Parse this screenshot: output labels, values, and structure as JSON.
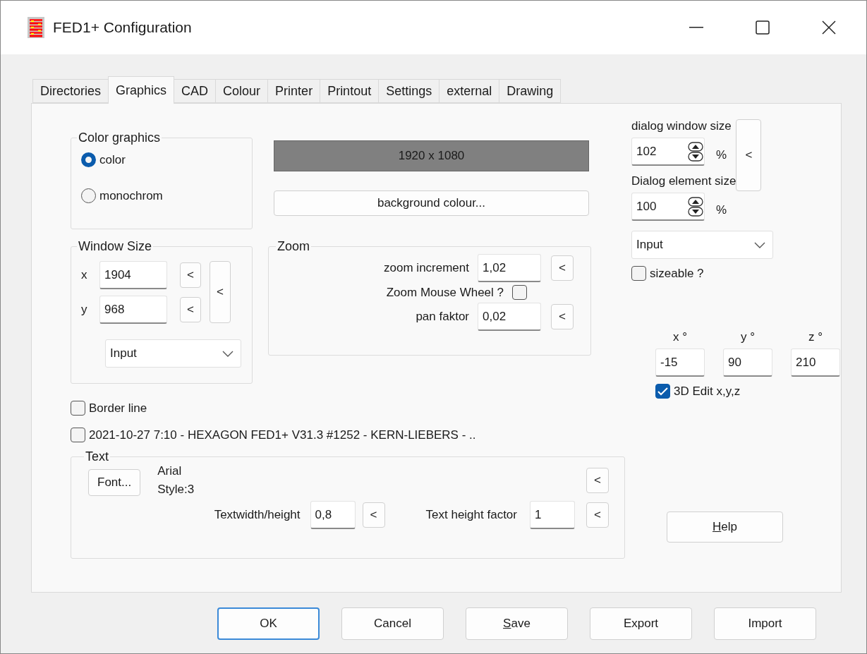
{
  "window": {
    "title": "FED1+ Configuration"
  },
  "tabs": [
    {
      "label": "Directories",
      "selected": false
    },
    {
      "label": "Graphics",
      "selected": true
    },
    {
      "label": "CAD",
      "selected": false
    },
    {
      "label": "Colour",
      "selected": false
    },
    {
      "label": "Printer",
      "selected": false
    },
    {
      "label": "Printout",
      "selected": false
    },
    {
      "label": "Settings",
      "selected": false
    },
    {
      "label": "external",
      "selected": false
    },
    {
      "label": "Drawing",
      "selected": false
    }
  ],
  "color_graphics": {
    "title": "Color graphics",
    "options": [
      {
        "label": "color",
        "selected": true
      },
      {
        "label": "monochrom",
        "selected": false
      }
    ]
  },
  "resolution": "1920 x 1080",
  "background_button": "background colour...",
  "window_size": {
    "title": "Window Size",
    "x": {
      "label": "x",
      "value": "1904",
      "reset": "<"
    },
    "y": {
      "label": "y",
      "value": "968",
      "reset": "<"
    },
    "reset_both": "<",
    "mode": "Input"
  },
  "zoom": {
    "title": "Zoom",
    "increment": {
      "label": "zoom increment",
      "value": "1,02",
      "reset": "<"
    },
    "mouse_wheel": {
      "label": "Zoom Mouse Wheel ?",
      "checked": false
    },
    "pan": {
      "label": "pan faktor",
      "value": "0,02",
      "reset": "<"
    }
  },
  "border_line": {
    "label": "Border line",
    "checked": false
  },
  "stamp": {
    "label": "2021-10-27 7:10 - HEXAGON FED1+ V31.3 #1252 - KERN-LIEBERS - ..",
    "checked": false
  },
  "text_group": {
    "title": "Text",
    "font_button": "Font...",
    "font_name": "Arial",
    "font_style": "Style:3",
    "font_reset": "<",
    "width_height": {
      "label": "Textwidth/height",
      "value": "0,8",
      "reset": "<"
    },
    "height_factor": {
      "label": "Text height factor",
      "value": "1",
      "reset": "<"
    }
  },
  "dialog": {
    "window_size": {
      "label": "dialog window size",
      "value": "102",
      "unit": "%"
    },
    "element_size": {
      "label": "Dialog element size",
      "value": "100",
      "unit": "%"
    },
    "reset": "<",
    "mode": "Input",
    "sizeable": {
      "label": "sizeable ?",
      "checked": false
    }
  },
  "rotation": {
    "axes": [
      {
        "label": "x °",
        "value": "-15"
      },
      {
        "label": "y °",
        "value": "90"
      },
      {
        "label": "z °",
        "value": "210"
      }
    ],
    "edit_3d": {
      "label": "3D Edit x,y,z",
      "checked": true
    }
  },
  "help_button": {
    "label": "Help",
    "mnemonic": true
  },
  "buttons": [
    {
      "label": "OK",
      "default": true,
      "mnemonic": false
    },
    {
      "label": "Cancel",
      "default": false,
      "mnemonic": false
    },
    {
      "label": "Save",
      "default": false,
      "mnemonic": true
    },
    {
      "label": "Export",
      "default": false,
      "mnemonic": false
    },
    {
      "label": "Import",
      "default": false,
      "mnemonic": false
    }
  ]
}
